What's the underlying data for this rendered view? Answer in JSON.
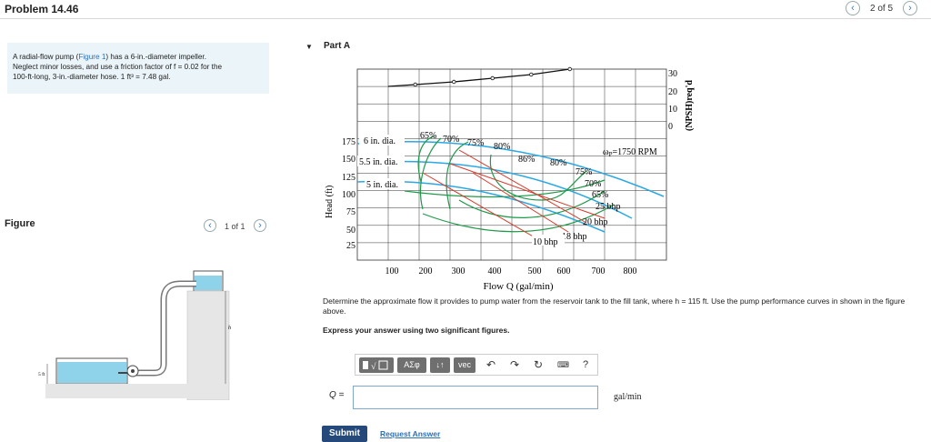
{
  "header": {
    "title": "Problem 14.46",
    "page_counter": "2 of 5",
    "prev_icon": "chevron-left-icon",
    "next_icon": "chevron-right-icon"
  },
  "problem": {
    "line1_a": "A radial-flow pump (",
    "figure_link": "Figure 1",
    "line1_b": ") has a 6-in.-diameter impeller.",
    "line2": "Neglect minor losses, and use a friction factor of f = 0.02 for the",
    "line3": "100-ft-long, 3-in.-diameter hose. 1 ft³ = 7.48 gal."
  },
  "figure_panel": {
    "label": "Figure",
    "counter": "1 of 1",
    "dim_5ft": "5 ft",
    "dim_h": "h"
  },
  "part_a": {
    "label": "Part A",
    "question": "Determine the approximate flow it provides to pump water from the reservoir tank to the fill tank, where h = 115 ft. Use the pump performance curves in shown in the figure above.",
    "instruction": "Express your answer using two significant figures.",
    "q_label": "Q =",
    "answer_value": "",
    "units": "gal/min",
    "submit_label": "Submit",
    "request_answer_label": "Request Answer"
  },
  "toolbar": {
    "templates_icon": "fraction-sqrt-template-icon",
    "greek_label": "ΑΣφ",
    "arrows_label": "↓↑",
    "vec_label": "vec",
    "undo_icon": "undo-icon",
    "redo_icon": "redo-icon",
    "reset_icon": "reset-icon",
    "keyboard_icon": "keyboard-icon",
    "help_label": "?"
  },
  "chart_data": {
    "type": "line",
    "xlabel": "Flow Q (gal/min)",
    "ylabel": "Head (ft)",
    "y2label": "(NPSH)req'd",
    "x_ticks": [
      "100",
      "200",
      "300",
      "400",
      "500",
      "600",
      "700",
      "800"
    ],
    "y_ticks": [
      "25",
      "50",
      "75",
      "100",
      "125",
      "150",
      "175"
    ],
    "y2_ticks": [
      "0",
      "10",
      "20",
      "30"
    ],
    "annotations": {
      "d6": "6 in. dia.",
      "d55": "5.5 in. dia.",
      "d5": "5 in. dia.",
      "e65": "65%",
      "e70": "70%",
      "e75": "75%",
      "e80a": "80%",
      "e86": "86%",
      "e80b": "80%",
      "e75b": "75%",
      "e70b": "70%",
      "e65b": "65%",
      "rpm": "ω",
      "rpm_sub": "P",
      "rpm_val": "=1750 RPM",
      "p25": "25 bhp",
      "p20": "20 bhp",
      "p18": "18 bhp",
      "p10": "10 bhp"
    },
    "series": [
      {
        "x": [
          130,
          200,
          300,
          400,
          500,
          600
        ],
        "values": [
          20.5,
          21.5,
          23,
          25,
          27,
          30
        ]
      }
    ],
    "colors": {
      "head": "#2aa8e6",
      "efficiency": "#1f9a4a",
      "power": "#d63a2a"
    }
  }
}
